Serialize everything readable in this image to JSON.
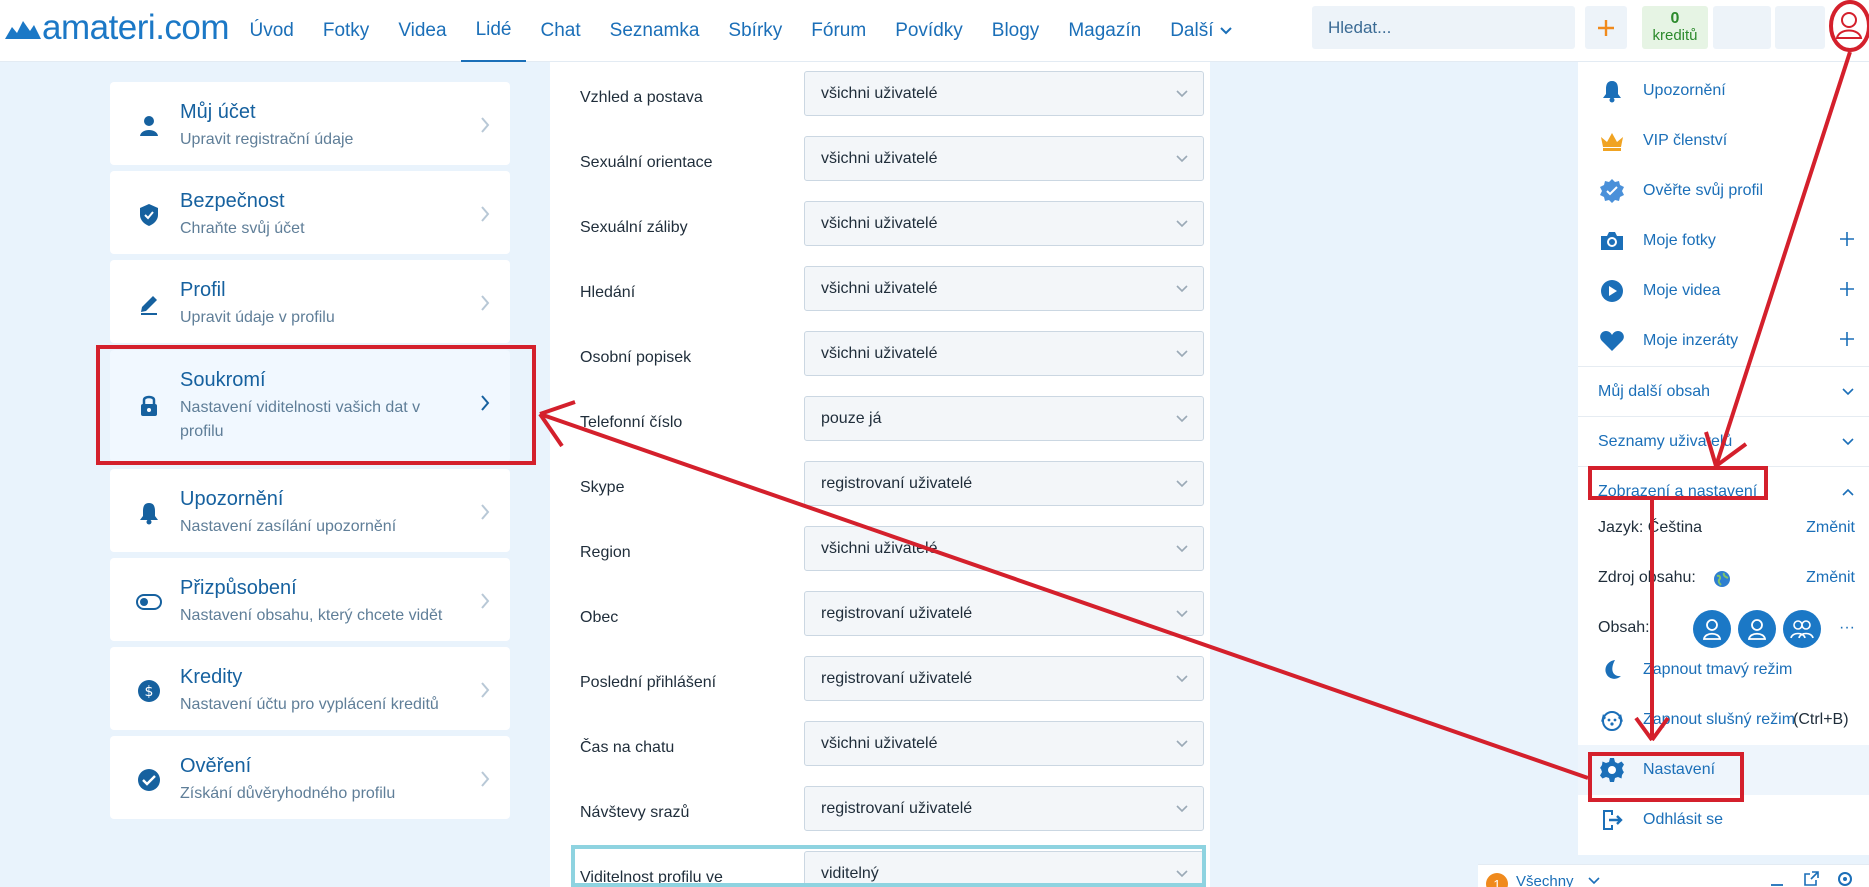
{
  "header": {
    "logo_text": "amateri.com",
    "nav": [
      "Úvod",
      "Fotky",
      "Videa",
      "Lidé",
      "Chat",
      "Seznamka",
      "Sbírky",
      "Fórum",
      "Povídky",
      "Blogy",
      "Magazín",
      "Další"
    ],
    "active_nav": "Lidé",
    "search_placeholder": "Hledat...",
    "credits_count": "0",
    "credits_label": "kreditů"
  },
  "sidebar": {
    "items": [
      {
        "title": "Můj účet",
        "subtitle": "Upravit registrační údaje",
        "icon": "user-icon"
      },
      {
        "title": "Bezpečnost",
        "subtitle": "Chraňte svůj účet",
        "icon": "shield-icon"
      },
      {
        "title": "Profil",
        "subtitle": "Upravit údaje v profilu",
        "icon": "pencil-icon"
      },
      {
        "title": "Soukromí",
        "subtitle": "Nastavení viditelnosti vašich dat v profilu",
        "icon": "lock-icon"
      },
      {
        "title": "Upozornění",
        "subtitle": "Nastavení zasílání upozornění",
        "icon": "bell-icon"
      },
      {
        "title": "Přizpůsobení",
        "subtitle": "Nastavení obsahu, který chcete vidět",
        "icon": "toggle-icon"
      },
      {
        "title": "Kredity",
        "subtitle": "Nastavení účtu pro vyplácení kreditů",
        "icon": "dollar-icon"
      },
      {
        "title": "Ověření",
        "subtitle": "Získání důvěryhodného profilu",
        "icon": "check-circle-icon"
      }
    ]
  },
  "privacy": {
    "rows": [
      {
        "label": "Vzhled a postava",
        "value": "všichni uživatelé"
      },
      {
        "label": "Sexuální orientace",
        "value": "všichni uživatelé"
      },
      {
        "label": "Sexuální záliby",
        "value": "všichni uživatelé"
      },
      {
        "label": "Hledání",
        "value": "všichni uživatelé"
      },
      {
        "label": "Osobní popisek",
        "value": "všichni uživatelé"
      },
      {
        "label": "Telefonní číslo",
        "value": "pouze já"
      },
      {
        "label": "Skype",
        "value": "registrovaní uživatelé"
      },
      {
        "label": "Region",
        "value": "všichni uživatelé"
      },
      {
        "label": "Obec",
        "value": "registrovaní uživatelé"
      },
      {
        "label": "Poslední přihlášení",
        "value": "registrovaní uživatelé"
      },
      {
        "label": "Čas na chatu",
        "value": "všichni uživatelé"
      },
      {
        "label": "Návštevy srazů",
        "value": "registrovaní uživatelé"
      },
      {
        "label": "Viditelnost profilu ve",
        "value": "viditelný"
      }
    ]
  },
  "user_menu": {
    "items": [
      {
        "label": "Upozornění",
        "icon": "bell-icon"
      },
      {
        "label": "VIP členství",
        "icon": "crown-icon"
      },
      {
        "label": "Ověřte svůj profil",
        "icon": "verified-badge-icon"
      },
      {
        "label": "Moje fotky",
        "icon": "camera-icon",
        "plus": "+"
      },
      {
        "label": "Moje videa",
        "icon": "play-icon",
        "plus": "+"
      },
      {
        "label": "Moje inzeráty",
        "icon": "heart-icon",
        "plus": "+"
      }
    ],
    "sections": [
      "Můj další obsah",
      "Seznamy uživatelů",
      "Zobrazení a nastavení"
    ],
    "language_label": "Jazyk:",
    "language_value": "Čeština",
    "change_label": "Změnit",
    "source_label": "Zdroj obsahu:",
    "content_label": "Obsah:",
    "more": "···",
    "dark_mode": "Zapnout tmavý režim",
    "safe_mode": "Zapnout slušný režim",
    "safe_mode_shortcut": "(Ctrl+B)",
    "settings": "Nastavení",
    "logout": "Odhlásit se"
  },
  "chat": {
    "badge": "1",
    "label": "Všechny"
  }
}
